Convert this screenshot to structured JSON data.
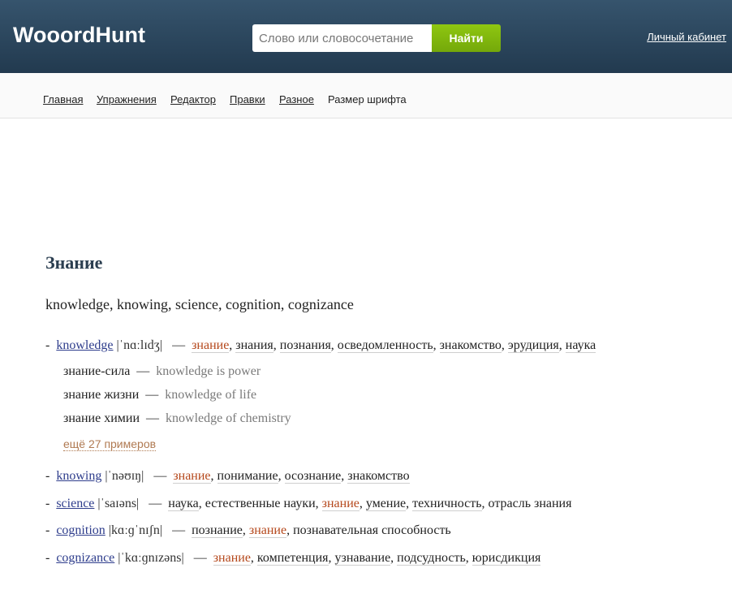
{
  "header": {
    "logo": "WooordHunt",
    "search_placeholder": "Слово или словосочетание",
    "search_button": "Найти",
    "cabinet_link": "Личный кабинет"
  },
  "nav": {
    "items": [
      "Главная",
      "Упражнения",
      "Редактор",
      "Правки",
      "Разное",
      "Размер шрифта"
    ]
  },
  "content": {
    "title": "Знание",
    "translations_line": "knowledge, knowing, science, cognition, cognizance",
    "entries": [
      {
        "word": "knowledge",
        "transcription": "|ˈnɑːlɪdʒ|",
        "translations": [
          {
            "text": "знание",
            "highlight": true,
            "underline": true
          },
          {
            "text": "знания",
            "highlight": false,
            "underline": true
          },
          {
            "text": "познания",
            "highlight": false,
            "underline": true
          },
          {
            "text": "осведомленность",
            "highlight": false,
            "underline": true
          },
          {
            "text": "знакомство",
            "highlight": false,
            "underline": true
          },
          {
            "text": "эрудиция",
            "highlight": false,
            "underline": true
          },
          {
            "text": "наука",
            "highlight": false,
            "underline": true
          }
        ],
        "examples": [
          {
            "ru": "знание-сила",
            "en": "knowledge is power"
          },
          {
            "ru": "знание жизни",
            "en": "knowledge of life"
          },
          {
            "ru": "знание химии",
            "en": "knowledge of chemistry"
          }
        ],
        "more_examples": "ещё 27 примеров"
      },
      {
        "word": "knowing",
        "transcription": "|ˈnəʊɪŋ|",
        "translations": [
          {
            "text": "знание",
            "highlight": true,
            "underline": true
          },
          {
            "text": "понимание",
            "highlight": false,
            "underline": true
          },
          {
            "text": "осознание",
            "highlight": false,
            "underline": true
          },
          {
            "text": "знакомство",
            "highlight": false,
            "underline": true
          }
        ]
      },
      {
        "word": "science",
        "transcription": "|ˈsaɪəns|",
        "translations": [
          {
            "text": "наука",
            "highlight": false,
            "underline": true
          },
          {
            "text": "естественные науки",
            "highlight": false,
            "underline": false
          },
          {
            "text": "знание",
            "highlight": true,
            "underline": true
          },
          {
            "text": "умение",
            "highlight": false,
            "underline": true
          },
          {
            "text": "техничность",
            "highlight": false,
            "underline": true
          },
          {
            "text": "отрасль знания",
            "highlight": false,
            "underline": false
          }
        ]
      },
      {
        "word": "cognition",
        "transcription": "|kɑːɡˈnɪʃn|",
        "translations": [
          {
            "text": "познание",
            "highlight": false,
            "underline": true
          },
          {
            "text": "знание",
            "highlight": true,
            "underline": true
          },
          {
            "text": "познавательная способность",
            "highlight": false,
            "underline": false
          }
        ]
      },
      {
        "word": "cognizance",
        "transcription": "|ˈkɑːɡnɪzəns|",
        "translations": [
          {
            "text": "знание",
            "highlight": true,
            "underline": true
          },
          {
            "text": "компетенция",
            "highlight": false,
            "underline": true
          },
          {
            "text": "узнавание",
            "highlight": false,
            "underline": true
          },
          {
            "text": "подсудность",
            "highlight": false,
            "underline": true
          },
          {
            "text": "юрисдикция",
            "highlight": false,
            "underline": true
          }
        ]
      }
    ]
  },
  "colors": {
    "header_top": "#36546d",
    "header_bottom": "#223a4f",
    "search_button": "#8fc711",
    "word_link": "#2e3d8c",
    "highlight": "#b5481c",
    "more_link": "#b07a52"
  }
}
